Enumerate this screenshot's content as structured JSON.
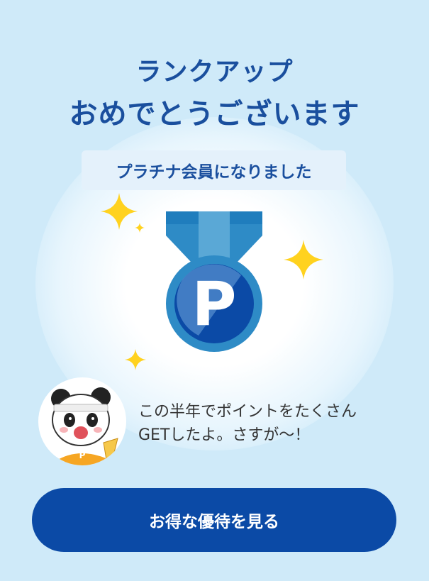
{
  "header": {
    "title_line1": "ランクアップ",
    "title_line2": "おめでとうございます"
  },
  "rank_badge": {
    "label": "プラチナ会員になりました"
  },
  "medal": {
    "icon": "medal-icon",
    "letter": "P"
  },
  "message": {
    "line1": "この半年でポイントをたくさん",
    "line2": "GETしたよ。さすが〜！",
    "avatar_icon": "panda-mascot-icon"
  },
  "cta": {
    "label": "お得な優待を見る"
  },
  "colors": {
    "background": "#cfeaf9",
    "title": "#1a4f9e",
    "button": "#0b4aa6",
    "sparkle": "#ffd21f",
    "medal_ribbon": "#2e8bc6",
    "medal_disc": "#0b4aa6"
  }
}
